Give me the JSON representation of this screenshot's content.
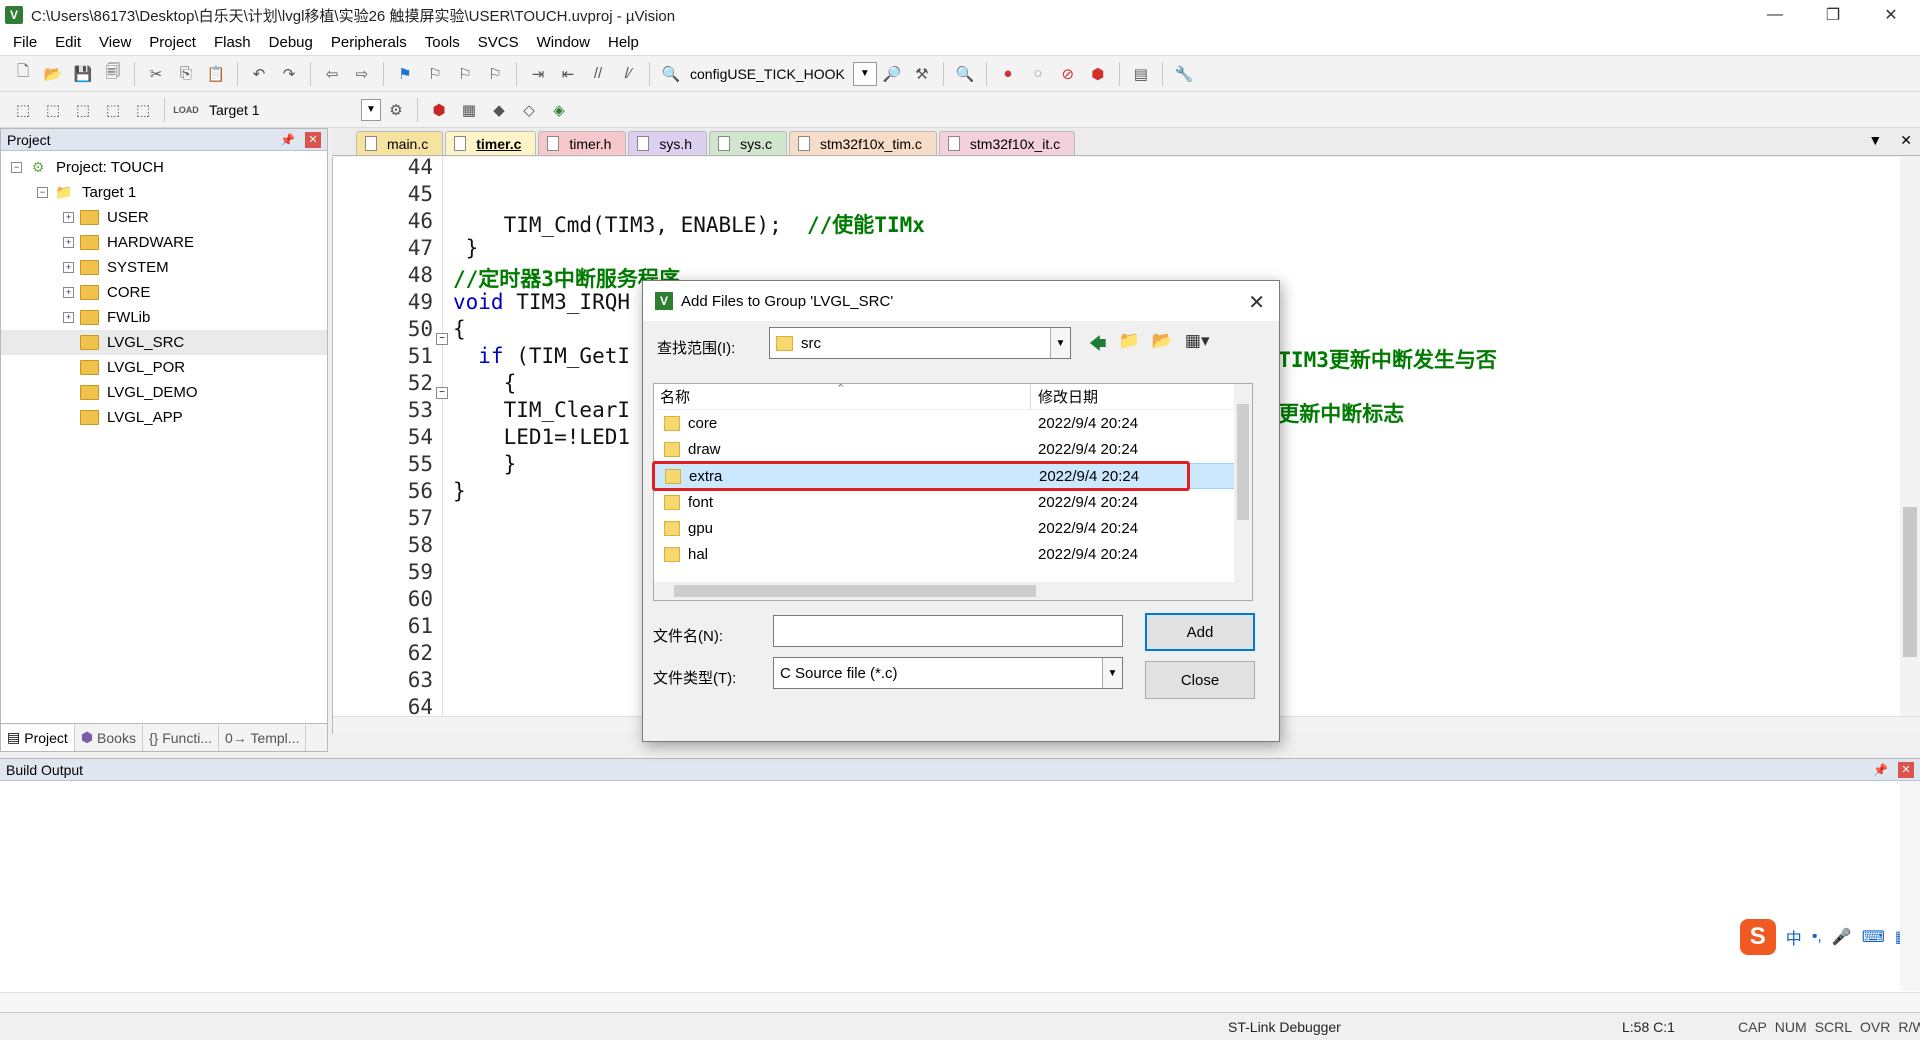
{
  "window": {
    "title": "C:\\Users\\86173\\Desktop\\白乐天\\计划\\lvgl移植\\实验26 触摸屏实验\\USER\\TOUCH.uvproj - µVision",
    "app_icon": "uvision-icon",
    "controls": {
      "minimize": "—",
      "restore": "❐",
      "close": "✕"
    }
  },
  "menu": [
    "File",
    "Edit",
    "View",
    "Project",
    "Flash",
    "Debug",
    "Peripherals",
    "Tools",
    "SVCS",
    "Window",
    "Help"
  ],
  "toolbar1": {
    "search_value": "configUSE_TICK_HOOK"
  },
  "toolbar2": {
    "target": "Target 1",
    "load_label": "LOAD"
  },
  "project_panel": {
    "title": "Project",
    "root": "Project: TOUCH",
    "target": "Target 1",
    "groups": [
      "USER",
      "HARDWARE",
      "SYSTEM",
      "CORE",
      "FWLib",
      "LVGL_SRC",
      "LVGL_POR",
      "LVGL_DEMO",
      "LVGL_APP"
    ],
    "selected_group": "LVGL_SRC",
    "tabs": [
      "Project",
      "Books",
      "{} Functi...",
      "0→ Templ..."
    ]
  },
  "editor": {
    "tabs": [
      "main.c",
      "timer.c",
      "timer.h",
      "sys.h",
      "sys.c",
      "stm32f10x_tim.c",
      "stm32f10x_it.c"
    ],
    "tab_colors": [
      "#f7e3a0",
      "#fdf5c8",
      "#f6c8cc",
      "#dcd0f0",
      "#cfe6cc",
      "#f7dcc8",
      "#f3d0dc"
    ],
    "active_tab": "timer.c",
    "line_numbers": [
      "44",
      "45",
      "46",
      "47",
      "48",
      "49",
      "50",
      "51",
      "52",
      "53",
      "54",
      "55",
      "56",
      "57",
      "58",
      "59",
      "60",
      "61",
      "62",
      "63",
      "64"
    ],
    "code": {
      "l46_code": "    TIM_Cmd(TIM3, ENABLE);  ",
      "l46_comment": "//使能TIMx",
      "l47": " }",
      "l48_comment": "//定时器3中断服务程序",
      "l49_kw": "void",
      "l49_rest": " TIM3_IRQH",
      "l50": "{",
      "l51_kw": "  if",
      "l51_rest": " (TIM_GetI",
      "l51_comment": "//TIM3更新中断发生与否",
      "l52": "    {",
      "l53": "    TIM_ClearI",
      "l53_comment": "//更新中断标志",
      "l54": "    LED1=!LED1",
      "l55": "    }",
      "l56": "}"
    }
  },
  "dialog": {
    "title": "Add Files to Group 'LVGL_SRC'",
    "look_in_label": "查找范围(I):",
    "look_in_value": "src",
    "col_name": "名称",
    "col_date": "修改日期",
    "files": [
      {
        "name": "core",
        "date": "2022/9/4 20:24"
      },
      {
        "name": "draw",
        "date": "2022/9/4 20:24"
      },
      {
        "name": "extra",
        "date": "2022/9/4 20:24"
      },
      {
        "name": "font",
        "date": "2022/9/4 20:24"
      },
      {
        "name": "gpu",
        "date": "2022/9/4 20:24"
      },
      {
        "name": "hal",
        "date": "2022/9/4 20:24"
      }
    ],
    "selected_file": "extra",
    "filename_label": "文件名(N):",
    "filename_value": "",
    "filetype_label": "文件类型(T):",
    "filetype_value": "C Source file (*.c)",
    "add_button": "Add",
    "close_button": "Close",
    "highlight_color": "#e02020"
  },
  "build_output": {
    "title": "Build Output",
    "ime": [
      "中",
      "•,",
      "🎤",
      "⌨",
      "▦"
    ]
  },
  "statusbar": {
    "debugger": "ST-Link Debugger",
    "position": "L:58 C:1",
    "flags": [
      "CAP",
      "NUM",
      "SCRL",
      "OVR",
      "R/W"
    ]
  }
}
